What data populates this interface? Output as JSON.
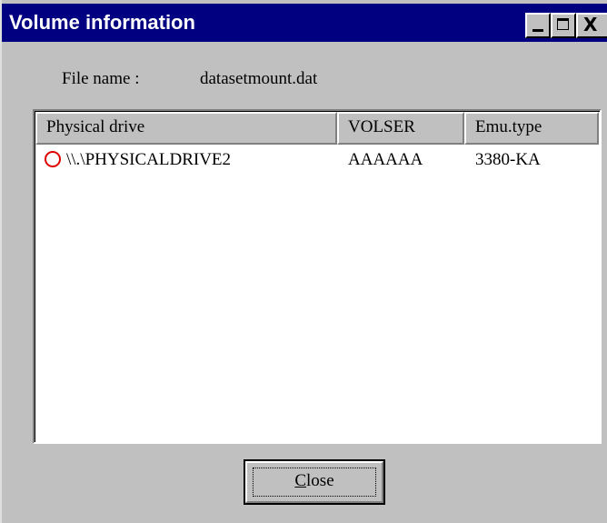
{
  "window": {
    "title": "Volume information"
  },
  "titlebar": {
    "minimize_icon": "minimize-icon",
    "maximize_icon": "maximize-icon",
    "close_icon": "close-icon",
    "close_glyph": "X"
  },
  "file": {
    "label": "File name :",
    "value": "datasetmount.dat"
  },
  "table": {
    "columns": [
      "Physical drive",
      "VOLSER",
      "Emu.type"
    ],
    "rows": [
      {
        "status_icon": "red-circle-icon",
        "status_color": "#e00000",
        "physical_drive": "\\\\.\\PHYSICALDRIVE2",
        "volser": "AAAAAA",
        "emu_type": "3380-KA"
      }
    ]
  },
  "buttons": {
    "close_label_first": "C",
    "close_label_rest": "lose"
  }
}
